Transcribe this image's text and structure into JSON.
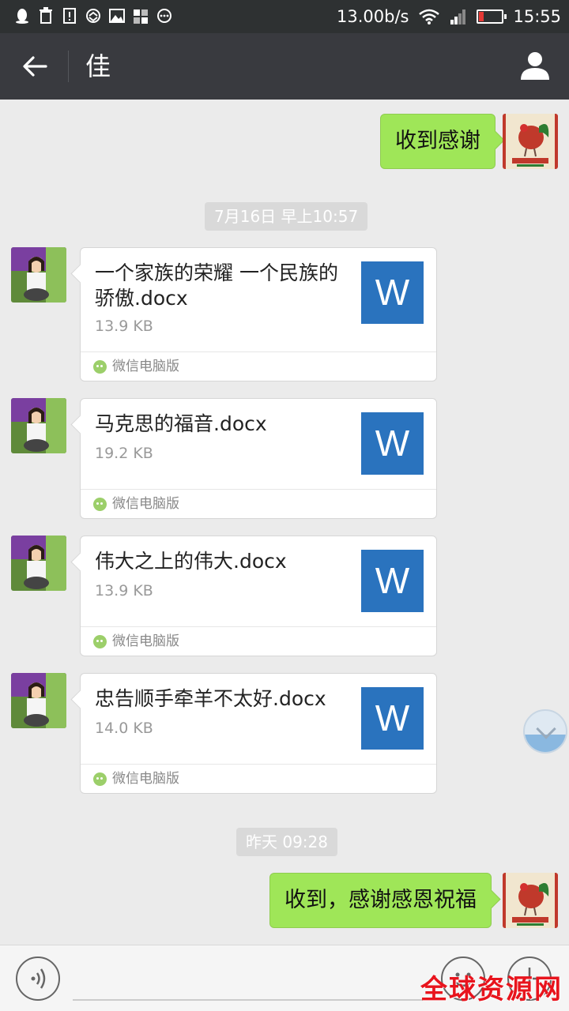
{
  "status_bar": {
    "network_speed": "13.00b/s",
    "time": "15:55",
    "battery_level": 0.2,
    "icons_left": [
      "qq-icon",
      "trash-icon",
      "alert-icon",
      "sync-icon",
      "image-icon",
      "grid-icon",
      "more-icon"
    ]
  },
  "header": {
    "title": "佳",
    "back_icon": "arrow-left-icon",
    "profile_icon": "person-icon"
  },
  "messages": [
    {
      "type": "text",
      "direction": "outgoing",
      "text": "收到感谢"
    },
    {
      "type": "timestamp",
      "text": "7月16日 早上10:57"
    },
    {
      "type": "file",
      "direction": "incoming",
      "name": "一个家族的荣耀  一个民族的骄傲.docx",
      "size": "13.9 KB",
      "source": "微信电脑版",
      "icon_letter": "W"
    },
    {
      "type": "file",
      "direction": "incoming",
      "name": "马克思的福音.docx",
      "size": "19.2 KB",
      "source": "微信电脑版",
      "icon_letter": "W"
    },
    {
      "type": "file",
      "direction": "incoming",
      "name": "伟大之上的伟大.docx",
      "size": "13.9 KB",
      "source": "微信电脑版",
      "icon_letter": "W"
    },
    {
      "type": "file",
      "direction": "incoming",
      "name": "忠告顺手牵羊不太好.docx",
      "size": "14.0 KB",
      "source": "微信电脑版",
      "icon_letter": "W"
    },
    {
      "type": "timestamp",
      "text": "昨天 09:28"
    },
    {
      "type": "text",
      "direction": "outgoing",
      "text": "收到，感谢感恩祝福"
    }
  ],
  "watermark": "全球资源网",
  "colors": {
    "status_bar_bg": "#2e3132",
    "header_bg": "#393a3f",
    "chat_bg": "#ebebeb",
    "outgoing_bubble": "#9fe658",
    "word_icon": "#2a73be",
    "watermark": "#e8141d"
  }
}
